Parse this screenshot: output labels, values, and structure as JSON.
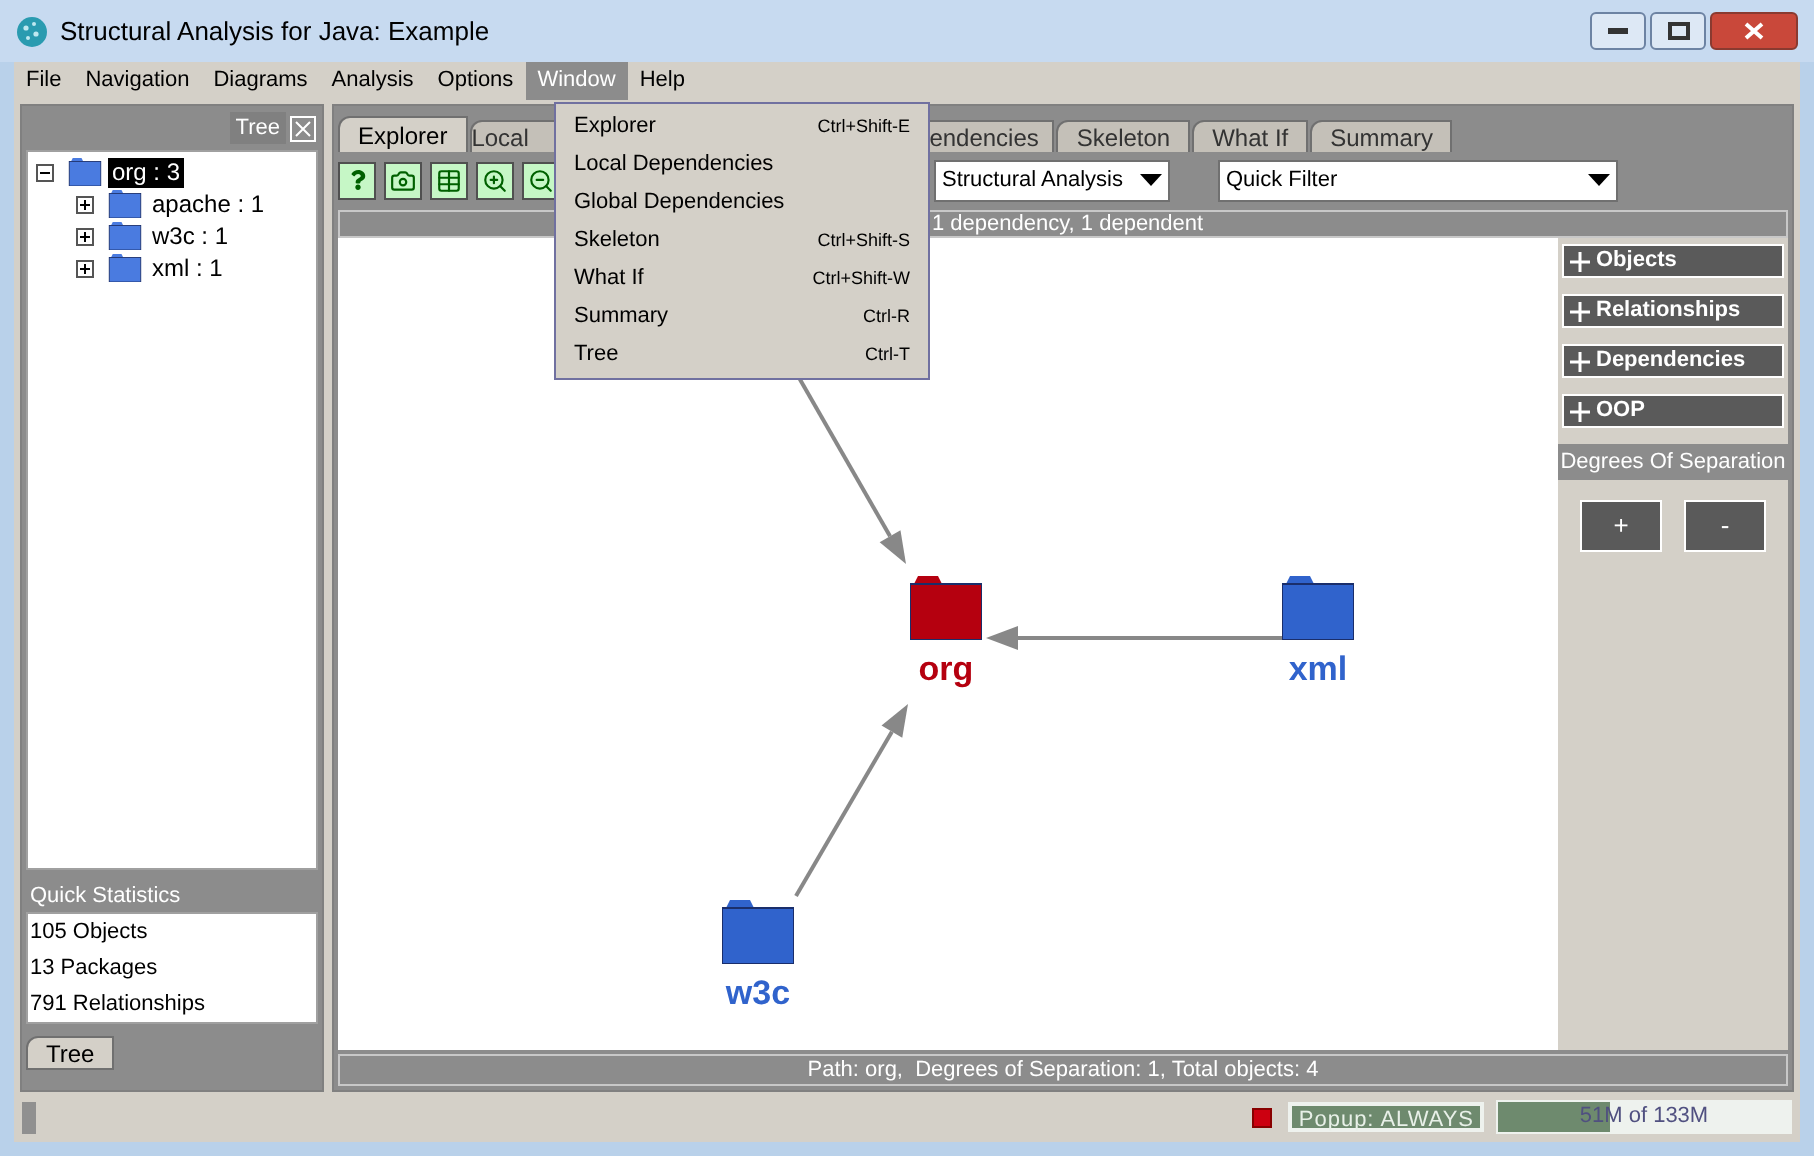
{
  "window": {
    "title": "Structural Analysis for Java: Example"
  },
  "menu_bar": [
    {
      "label": "File",
      "selected": false
    },
    {
      "label": "Navigation",
      "selected": false
    },
    {
      "label": "Diagrams",
      "selected": false
    },
    {
      "label": "Analysis",
      "selected": false
    },
    {
      "label": "Options",
      "selected": false
    },
    {
      "label": "Window",
      "selected": true
    },
    {
      "label": "Help",
      "selected": false
    }
  ],
  "window_menu": [
    {
      "label": "Explorer",
      "shortcut": "Ctrl+Shift-E"
    },
    {
      "label": "Local Dependencies"
    },
    {
      "label": "Global Dependencies"
    },
    {
      "label": "Skeleton",
      "shortcut": "Ctrl+Shift-S"
    },
    {
      "label": "What If",
      "shortcut": "Ctrl+Shift-W"
    },
    {
      "label": "Summary",
      "shortcut": "Ctrl-R"
    },
    {
      "label": "Tree",
      "shortcut": "Ctrl-T"
    }
  ],
  "left_panel": {
    "title": "Tree",
    "tree": [
      {
        "label": "org : 3",
        "expanded": true,
        "selected": true,
        "children": [
          {
            "label": "apache : 1",
            "expanded": false,
            "selected": false
          },
          {
            "label": "w3c : 1",
            "expanded": false,
            "selected": false
          },
          {
            "label": "xml : 1",
            "expanded": false,
            "selected": false
          }
        ]
      }
    ],
    "stats_title": "Quick Statistics",
    "stats": [
      "105 Objects",
      "13 Packages",
      "791 Relationships"
    ],
    "tab": "Tree"
  },
  "tabs": [
    {
      "label": "Explorer",
      "selected": true
    },
    {
      "label": "Local",
      "selected": false
    },
    {
      "label": "endencies",
      "selected": false
    },
    {
      "label": "Skeleton",
      "selected": false
    },
    {
      "label": "What If",
      "selected": false
    },
    {
      "label": "Summary",
      "selected": false
    }
  ],
  "toolbar": {
    "view_select": "Structural Analysis",
    "filter_select": "Quick Filter"
  },
  "info_bar": "1 dependency, 1 dependent",
  "diagram": {
    "nodes": [
      {
        "label": "org",
        "color": "#b5000f"
      },
      {
        "label": "xml",
        "color": "#3063cc"
      },
      {
        "label": "w3c",
        "color": "#3063cc"
      }
    ]
  },
  "side_panel": {
    "sections": [
      "Objects",
      "Relationships",
      "Dependencies",
      "OOP"
    ],
    "degrees_title": "Degrees Of Separation",
    "buttons": [
      "+",
      "-"
    ]
  },
  "path_bar": "Path: org,  Degrees of Separation: 1, Total objects: 4",
  "status_bar": {
    "popup": "Popup: ALWAYS",
    "memory": {
      "reading": "51M of 133M",
      "level": 0.38
    }
  }
}
